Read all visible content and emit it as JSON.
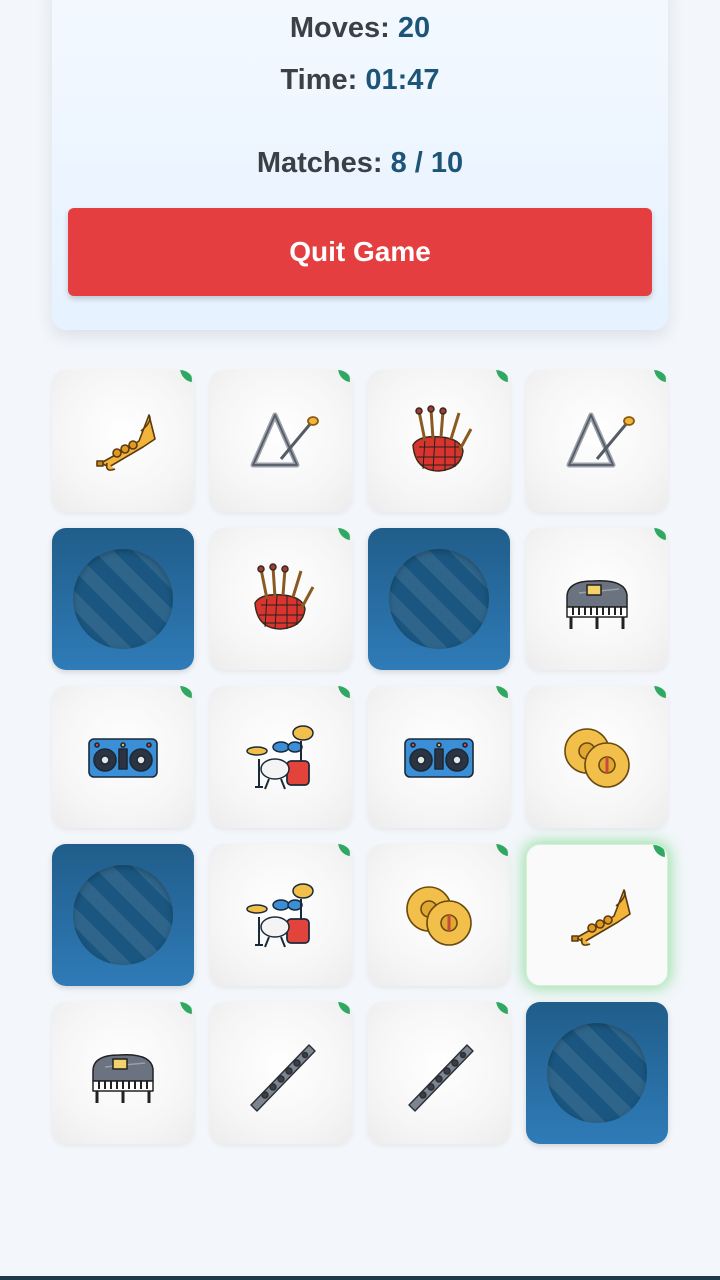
{
  "stats": {
    "moves_label": "Moves:",
    "moves_value": "20",
    "time_label": "Time:",
    "time_value": "01:47",
    "matches_label": "Matches:",
    "matches_value": "8 / 10"
  },
  "quit_label": "Quit Game",
  "cards": [
    {
      "state": "matched",
      "icon": "trumpet-icon"
    },
    {
      "state": "matched",
      "icon": "triangle-icon"
    },
    {
      "state": "matched",
      "icon": "bagpipes-icon"
    },
    {
      "state": "matched",
      "icon": "triangle-icon"
    },
    {
      "state": "hidden"
    },
    {
      "state": "matched",
      "icon": "bagpipes-icon"
    },
    {
      "state": "hidden"
    },
    {
      "state": "matched",
      "icon": "grand-piano-icon"
    },
    {
      "state": "matched",
      "icon": "dj-controller-icon"
    },
    {
      "state": "matched",
      "icon": "drum-kit-icon"
    },
    {
      "state": "matched",
      "icon": "dj-controller-icon"
    },
    {
      "state": "matched",
      "icon": "cymbals-icon"
    },
    {
      "state": "hidden"
    },
    {
      "state": "matched",
      "icon": "drum-kit-icon"
    },
    {
      "state": "matched",
      "icon": "cymbals-icon"
    },
    {
      "state": "selected",
      "icon": "trumpet-icon"
    },
    {
      "state": "matched",
      "icon": "grand-piano-icon"
    },
    {
      "state": "matched",
      "icon": "flute-icon"
    },
    {
      "state": "matched",
      "icon": "flute-icon"
    },
    {
      "state": "hidden"
    }
  ],
  "colors": {
    "quit_button": "#e53e41",
    "card_back": "#2a6fa3",
    "matched_marker": "#2fa862",
    "stat_value": "#1c5578"
  }
}
